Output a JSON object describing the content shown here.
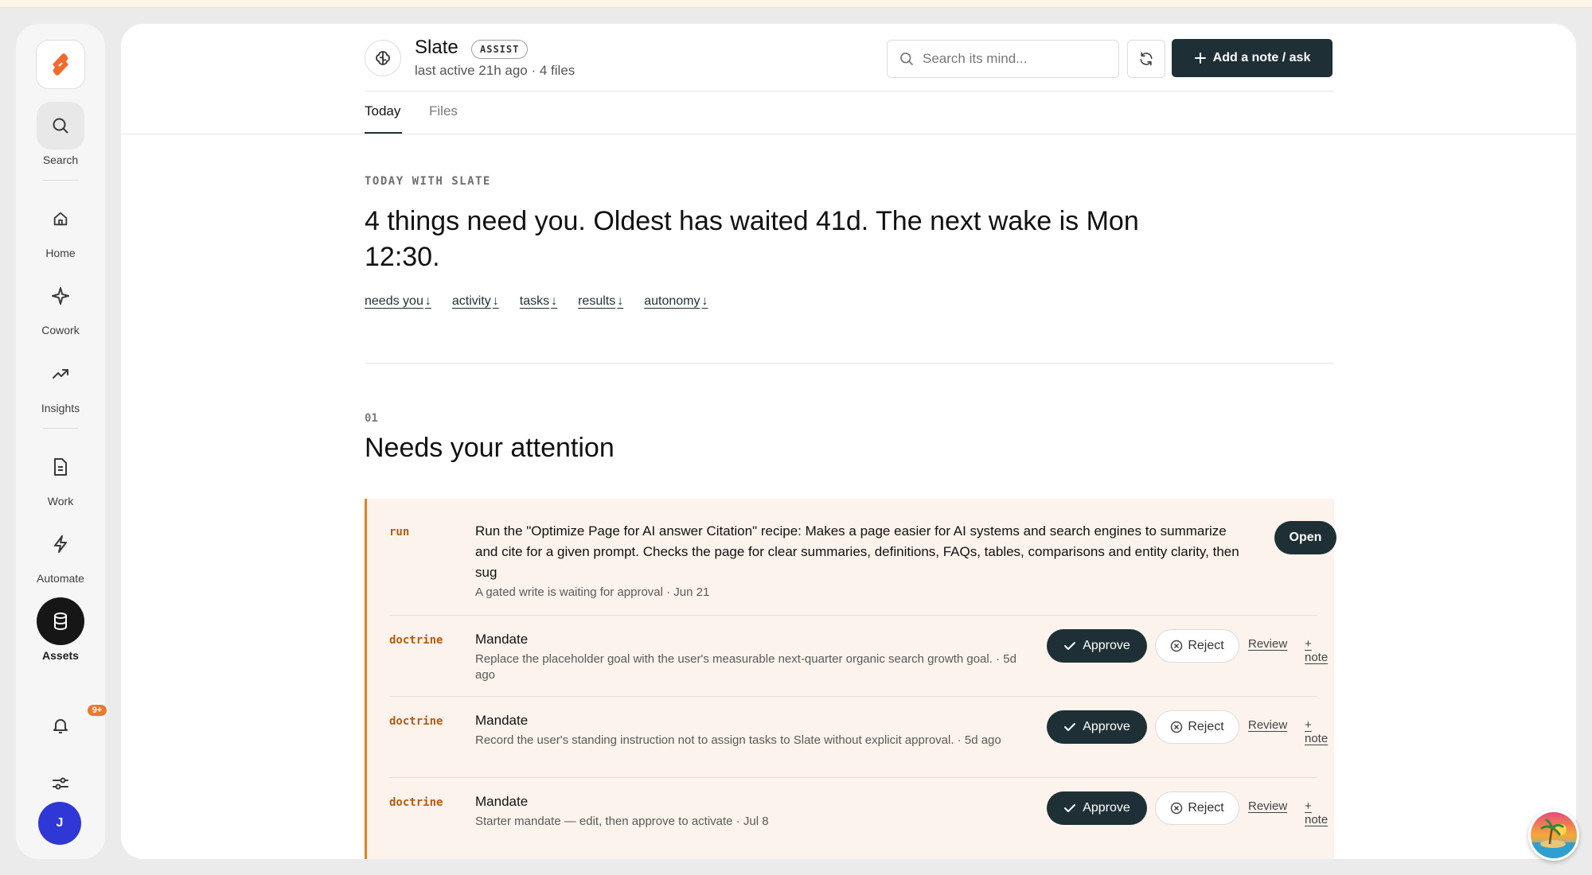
{
  "sidebar": {
    "items": [
      {
        "label": "Search",
        "icon": "search-icon"
      },
      {
        "label": "Home",
        "icon": "home-icon"
      },
      {
        "label": "Cowork",
        "icon": "sparkle-icon"
      },
      {
        "label": "Insights",
        "icon": "trend-up-icon"
      },
      {
        "label": "Work",
        "icon": "document-icon"
      },
      {
        "label": "Automate",
        "icon": "lightning-icon"
      },
      {
        "label": "Assets",
        "icon": "database-icon"
      }
    ],
    "notifications_badge": "9+",
    "avatar_initial": "J"
  },
  "header": {
    "agent_name": "Slate",
    "agent_badge": "ASSIST",
    "agent_meta": "last active 21h ago · 4 files",
    "search_placeholder": "Search its mind...",
    "add_button_label": "Add a note / ask"
  },
  "tabs": [
    {
      "label": "Today",
      "active": true
    },
    {
      "label": "Files",
      "active": false
    }
  ],
  "today": {
    "eyebrow": "TODAY WITH SLATE",
    "headline": "4 things need you. Oldest has waited 41d. The next wake is Mon 12:30.",
    "jump_links": [
      "needs you",
      "activity",
      "tasks",
      "results",
      "autonomy"
    ]
  },
  "section": {
    "number": "01",
    "title": "Needs your attention"
  },
  "attention_items": [
    {
      "kind": "run",
      "title": "Run the \"Optimize Page for AI answer Citation\" recipe: Makes a page easier for AI systems and search engines to summarize and cite for a given prompt. Checks the page for clear summaries, definitions, FAQs, tables, comparisons and entity clarity, then sug",
      "desc": "A gated write is waiting for approval · Jun 21",
      "action": "Open"
    },
    {
      "kind": "doctrine",
      "title": "Mandate",
      "desc": "Replace the placeholder goal with the user's measurable next-quarter organic search growth goal. · 5d ago"
    },
    {
      "kind": "doctrine",
      "title": "Mandate",
      "desc": "Record the user's standing instruction not to assign tasks to Slate without explicit approval. · 5d ago"
    },
    {
      "kind": "doctrine",
      "title": "Mandate",
      "desc": "Starter mandate — edit, then approve to activate · Jul 8"
    }
  ],
  "actions": {
    "approve": "Approve",
    "reject": "Reject",
    "review": "Review",
    "note": "+ note"
  },
  "colors": {
    "accent_dark": "#1e3035",
    "attention_bg": "#fcf3ec",
    "attention_border": "#e2801f",
    "kind_text": "#b55a12",
    "badge_orange": "#ec7a2a",
    "avatar_blue": "#2f37d6"
  }
}
